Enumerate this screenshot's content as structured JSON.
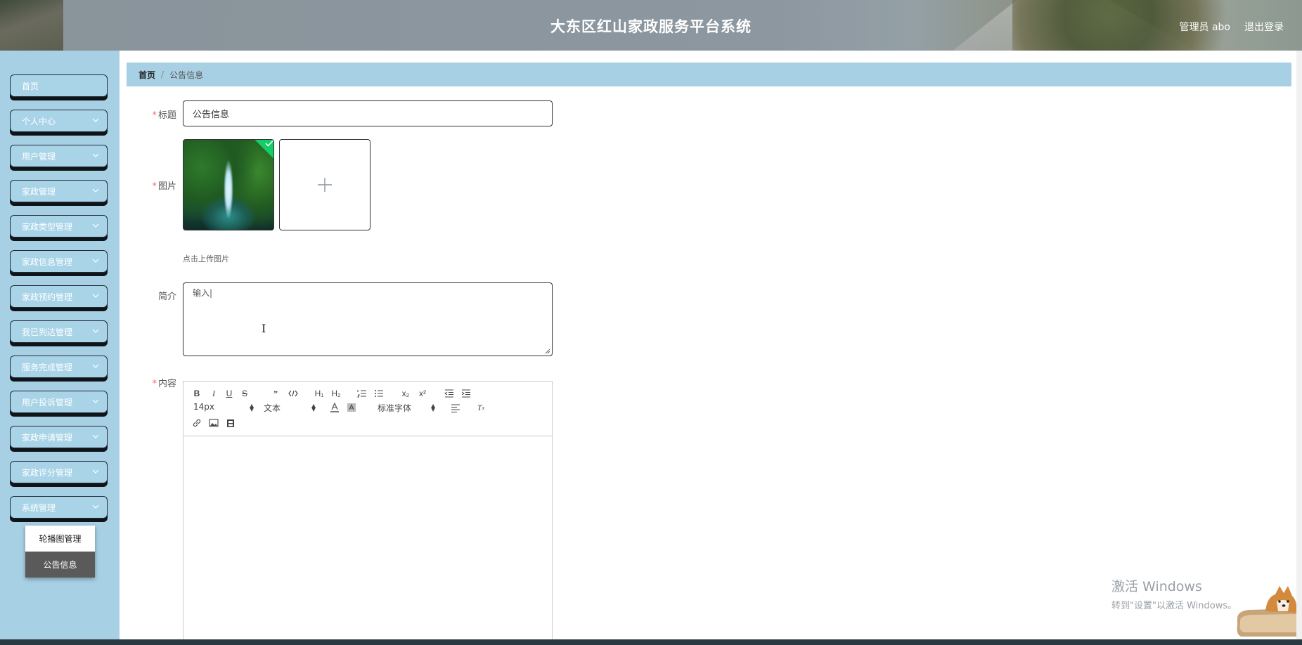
{
  "header": {
    "title": "大东区红山家政服务平台系统",
    "user_label": "管理员 abo",
    "logout_label": "退出登录"
  },
  "sidebar": {
    "items": [
      {
        "label": "首页",
        "expandable": false
      },
      {
        "label": "个人中心",
        "expandable": true
      },
      {
        "label": "用户管理",
        "expandable": true
      },
      {
        "label": "家政管理",
        "expandable": true
      },
      {
        "label": "家政类型管理",
        "expandable": true
      },
      {
        "label": "家政信息管理",
        "expandable": true
      },
      {
        "label": "家政预约管理",
        "expandable": true
      },
      {
        "label": "我已到达管理",
        "expandable": true
      },
      {
        "label": "服务完成管理",
        "expandable": true
      },
      {
        "label": "用户投诉管理",
        "expandable": true
      },
      {
        "label": "家政申请管理",
        "expandable": true
      },
      {
        "label": "家政评分管理",
        "expandable": true
      },
      {
        "label": "系统管理",
        "expandable": true
      }
    ],
    "submenu": [
      {
        "label": "轮播图管理",
        "active": false
      },
      {
        "label": "公告信息",
        "active": true
      }
    ]
  },
  "breadcrumb": {
    "home": "首页",
    "current": "公告信息"
  },
  "form": {
    "title_label": "标题",
    "title_value": "公告信息",
    "image_label": "图片",
    "upload_tip": "点击上传图片",
    "intro_label": "简介",
    "intro_value": "输入|",
    "content_label": "内容"
  },
  "editor": {
    "font_size": "14px",
    "block_format": "文本",
    "font_family": "标准字体",
    "buttons": [
      "bold",
      "italic",
      "underline",
      "strike",
      "blockquote",
      "code-block",
      "header-1",
      "header-2",
      "ordered-list",
      "bullet-list",
      "subscript",
      "superscript",
      "outdent",
      "indent",
      "color",
      "background",
      "align",
      "clean",
      "link",
      "image",
      "video"
    ]
  },
  "watermark": {
    "line1": "激活 Windows",
    "line2": "转到\"设置\"以激活 Windows。"
  }
}
